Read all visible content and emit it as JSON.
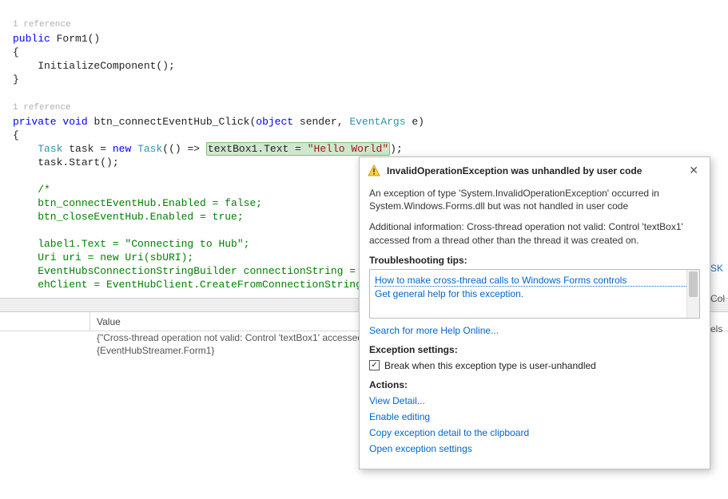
{
  "code": {
    "ref1": "1 reference",
    "ctor_sig_kw": "public",
    "ctor_sig_name": " Form1()",
    "brace_open": "{",
    "init_call": "    InitializeComponent();",
    "brace_close": "}",
    "ref2": "1 reference",
    "handler_kw1": "private",
    "handler_kw2": "void",
    "handler_name": " btn_connectEventHub_Click(",
    "handler_kw3": "object",
    "handler_mid": " sender, ",
    "handler_type": "EventArgs",
    "handler_end": " e)",
    "task_pre": "    ",
    "task_type1": "Task",
    "task_mid1": " task = ",
    "task_kw_new": "new",
    "task_sp": " ",
    "task_type2": "Task",
    "task_mid2": "(() => ",
    "task_hl": "textBox1.Text = ",
    "task_str": "\"Hello World\"",
    "task_end": ");",
    "task_start": "    task.Start();",
    "c1": "    /*",
    "c2": "    btn_connectEventHub.Enabled = false;",
    "c3": "    btn_closeEventHub.Enabled = true;",
    "c4": "    label1.Text = \"Connecting to Hub\";",
    "c5": "    Uri uri = new Uri(sbURI);",
    "c6": "    EventHubsConnectionStringBuilder connectionString = new Ev",
    "c7": "    ehClient = EventHubClient.CreateFromConnectionString(conn"
  },
  "grid": {
    "header_value": "Value",
    "row1": "{\"Cross-thread operation not valid: Control 'textBox1' accessed",
    "row2": "{EventHubStreamer.Form1}"
  },
  "right": {
    "sk": "SK",
    "col": "Col",
    "els": "els"
  },
  "popup": {
    "title": "InvalidOperationException was unhandled by user code",
    "para1": "An exception of type 'System.InvalidOperationException' occurred in System.Windows.Forms.dll but was not handled in user code",
    "para2": "Additional information: Cross-thread operation not valid: Control 'textBox1' accessed from a thread other than the thread it was created on.",
    "tips_title": "Troubleshooting tips:",
    "tip1": "How to make cross-thread calls to Windows Forms controls",
    "tip2": "Get general help for this exception.",
    "search_online": "Search for more Help Online...",
    "settings_title": "Exception settings:",
    "chk_label": "Break when this exception type is user-unhandled",
    "chk_checked": true,
    "actions_title": "Actions:",
    "a1": "View Detail...",
    "a2": "Enable editing",
    "a3": "Copy exception detail to the clipboard",
    "a4": "Open exception settings"
  }
}
